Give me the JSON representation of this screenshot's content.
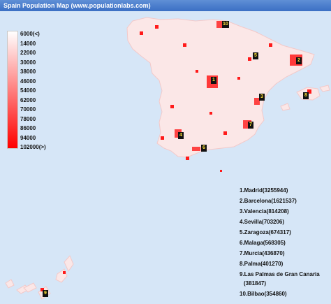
{
  "title": "Spain Population Map (www.populationlabs.com)",
  "legend": {
    "colors": {
      "low": "#ffffff",
      "high": "#ff0000"
    },
    "labels": [
      "6000(<)",
      "14000",
      "22000",
      "30000",
      "38000",
      "46000",
      "54000",
      "62000",
      "70000",
      "78000",
      "86000",
      "94000",
      "102000(>)"
    ]
  },
  "cities": [
    {
      "rank": "1",
      "label": "1.Madrid(3255944)"
    },
    {
      "rank": "2",
      "label": "2.Barcelona(1621537)"
    },
    {
      "rank": "3",
      "label": "3.Valencia(814208)"
    },
    {
      "rank": "4",
      "label": "4.Sevilla(703206)"
    },
    {
      "rank": "5",
      "label": "5.Zaragoza(674317)"
    },
    {
      "rank": "6",
      "label": "6.Malaga(568305)"
    },
    {
      "rank": "7",
      "label": "7.Murcia(436870)"
    },
    {
      "rank": "8",
      "label": "8.Palma(401270)"
    },
    {
      "rank": "9",
      "label": "9.Las Palmas de Gran Canaria",
      "label_cont": "(381847)"
    },
    {
      "rank": "10",
      "label": "10.Bilbao(354860)"
    }
  ],
  "colors": {
    "sea": "#d6e6f7",
    "land": "#fbe7e7",
    "hotspot": "#ff1a1a"
  }
}
